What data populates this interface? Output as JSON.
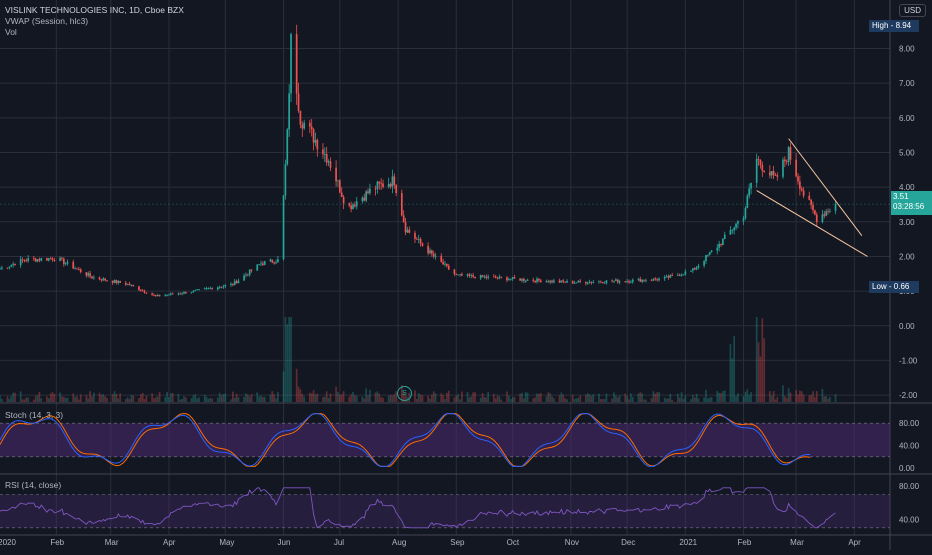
{
  "header": {
    "symbol_line": "VISLINK TECHNOLOGIES INC, 1D, Cboe BZX",
    "vwap_label": "VWAP (Session, hlc3)",
    "vol_label": "Vol",
    "currency_badge": "USD"
  },
  "price_pane": {
    "high_label": "High",
    "high_value": "8.94",
    "low_label": "Low",
    "low_value": "0.66",
    "last_price": "3.51",
    "countdown": "03:28:56",
    "split_marker": "S",
    "ticks": [
      "8.00",
      "7.00",
      "6.00",
      "5.00",
      "4.00",
      "3.00",
      "2.00",
      "1.00",
      "0.00",
      "-1.00",
      "-2.00"
    ]
  },
  "stoch_pane": {
    "label": "Stoch (14, 3, 3)",
    "ticks": [
      "80.00",
      "40.00",
      "0.00"
    ]
  },
  "rsi_pane": {
    "label": "RSI (14, close)",
    "ticks": [
      "80.00",
      "40.00"
    ]
  },
  "time_axis": {
    "labels": [
      "2020",
      "Feb",
      "Mar",
      "Apr",
      "May",
      "Jun",
      "Jul",
      "Aug",
      "Sep",
      "Oct",
      "Nov",
      "Dec",
      "2021",
      "Feb",
      "Mar",
      "Apr"
    ]
  },
  "colors": {
    "background": "#131722",
    "up": "#26a69a",
    "down": "#ef5350",
    "stoch_k": "#2962ff",
    "stoch_d": "#ff6d00",
    "rsi": "#7e57c2",
    "band": "#4a2a6f",
    "trendline": "#f7c59f",
    "badge": "#1e3a5f"
  },
  "chart_data": {
    "type": "candlestick",
    "x_start": "2020-01-02",
    "x_end": "2021-04-20",
    "y_range": [
      -2.2,
      9.4
    ],
    "price_path": [
      [
        "2020-01-02",
        1.65
      ],
      [
        "2020-01-15",
        1.9
      ],
      [
        "2020-02-01",
        1.95
      ],
      [
        "2020-02-20",
        1.4
      ],
      [
        "2020-03-10",
        1.2
      ],
      [
        "2020-03-25",
        0.85
      ],
      [
        "2020-04-15",
        1.0
      ],
      [
        "2020-05-05",
        1.2
      ],
      [
        "2020-05-20",
        1.8
      ],
      [
        "2020-05-30",
        1.9
      ],
      [
        "2020-06-03",
        5.5
      ],
      [
        "2020-06-05",
        8.2
      ],
      [
        "2020-06-10",
        6.0
      ],
      [
        "2020-06-25",
        4.8
      ],
      [
        "2020-07-05",
        3.4
      ],
      [
        "2020-07-20",
        4.0
      ],
      [
        "2020-07-30",
        4.2
      ],
      [
        "2020-08-05",
        2.8
      ],
      [
        "2020-08-20",
        2.0
      ],
      [
        "2020-09-01",
        1.45
      ],
      [
        "2020-10-01",
        1.35
      ],
      [
        "2020-11-01",
        1.25
      ],
      [
        "2020-12-01",
        1.3
      ],
      [
        "2020-12-20",
        1.35
      ],
      [
        "2021-01-05",
        1.6
      ],
      [
        "2021-01-20",
        2.4
      ],
      [
        "2021-02-01",
        3.2
      ],
      [
        "2021-02-08",
        4.8
      ],
      [
        "2021-02-18",
        4.2
      ],
      [
        "2021-02-25",
        5.0
      ],
      [
        "2021-03-05",
        3.8
      ],
      [
        "2021-03-12",
        3.1
      ],
      [
        "2021-03-22",
        3.51
      ]
    ],
    "volume_spikes": [
      "2020-06-04",
      "2021-02-10",
      "2021-01-25"
    ],
    "stochastic_k_range": [
      0,
      100
    ],
    "rsi_range": [
      25,
      85
    ],
    "trendlines": [
      {
        "from": [
          "2021-02-25",
          5.4
        ],
        "to": [
          "2021-04-05",
          2.6
        ]
      },
      {
        "from": [
          "2021-02-08",
          3.9
        ],
        "to": [
          "2021-04-08",
          2.0
        ]
      }
    ]
  }
}
